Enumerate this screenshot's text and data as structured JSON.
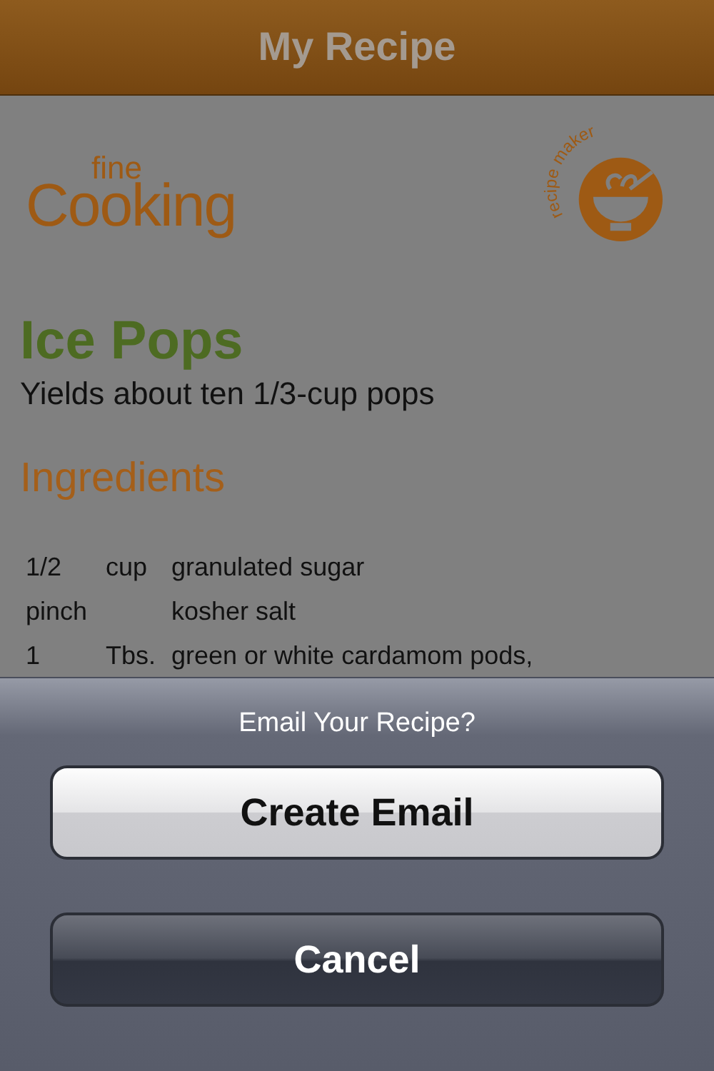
{
  "nav_bar": {
    "title": "My Recipe"
  },
  "logos": {
    "brand_small": "fine",
    "brand_large": "Cooking",
    "badge_text": "recipe maker"
  },
  "recipe": {
    "title": "Ice Pops",
    "yield": "Yields about ten 1/3-cup pops",
    "ingredients_heading": "Ingredients",
    "ingredients": [
      {
        "quantity": "1/2",
        "unit": "cup",
        "item": "granulated sugar"
      },
      {
        "quantity": "pinch",
        "item": "kosher salt"
      },
      {
        "quantity": "1",
        "unit": "Tbs.",
        "item": "green or white cardamom pods,"
      }
    ]
  },
  "action_sheet": {
    "title": "Email Your Recipe?",
    "buttons": [
      {
        "label": "Create Email",
        "kind": "default"
      },
      {
        "label": "Cancel",
        "kind": "cancel"
      }
    ]
  }
}
